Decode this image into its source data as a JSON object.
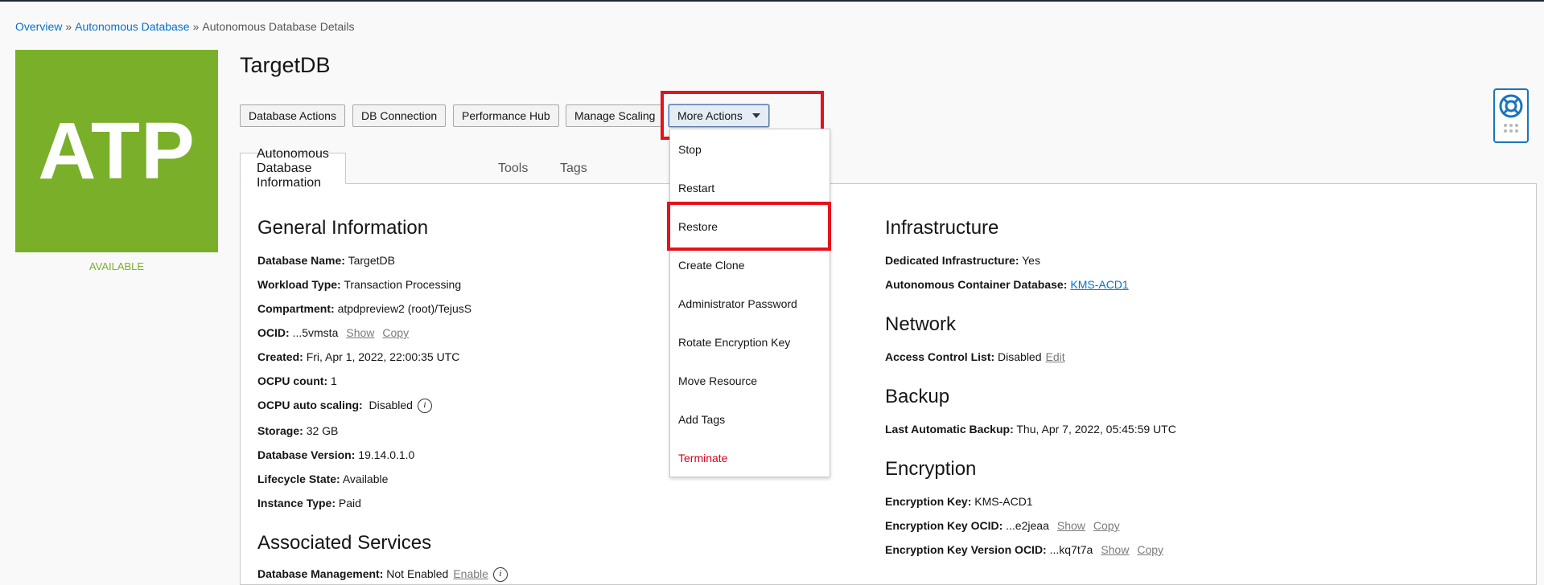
{
  "breadcrumb": {
    "items": [
      "Overview",
      "Autonomous Database",
      "Autonomous Database Details"
    ],
    "separator": "»"
  },
  "badge": {
    "text": "ATP",
    "status": "AVAILABLE",
    "color": "#7aaf29"
  },
  "title": "TargetDB",
  "actions": {
    "database_actions": "Database Actions",
    "db_connection": "DB Connection",
    "performance_hub": "Performance Hub",
    "manage_scaling": "Manage Scaling",
    "more_actions": "More Actions"
  },
  "tabs": [
    "Autonomous Database Information",
    "Tools",
    "Tags"
  ],
  "menu": {
    "items": [
      "Stop",
      "Restart",
      "Restore",
      "Create Clone",
      "Administrator Password",
      "Rotate Encryption Key",
      "Move Resource",
      "Add Tags",
      "Terminate"
    ]
  },
  "general": {
    "heading": "General Information",
    "rows": [
      {
        "label": "Database Name:",
        "value": "TargetDB"
      },
      {
        "label": "Workload Type:",
        "value": "Transaction Processing"
      },
      {
        "label": "Compartment:",
        "value": "atpdpreview2 (root)/TejusS"
      },
      {
        "label": "OCID:",
        "value": "...5vmsta",
        "link1": "Show",
        "link2": "Copy"
      },
      {
        "label": "Created:",
        "value": "Fri, Apr 1, 2022, 22:00:35 UTC"
      },
      {
        "label": "OCPU count:",
        "value": "1"
      },
      {
        "label": "OCPU auto scaling:",
        "value": "Disabled",
        "icon": "i"
      },
      {
        "label": "Storage:",
        "value": "32 GB"
      },
      {
        "label": "Database Version:",
        "value": "19.14.0.1.0"
      },
      {
        "label": "Lifecycle State:",
        "value": "Available"
      },
      {
        "label": "Instance Type:",
        "value": "Paid"
      }
    ]
  },
  "associated": {
    "heading": "Associated Services",
    "rows": [
      {
        "label": "Database Management:",
        "value": "Not Enabled",
        "link": "Enable",
        "icon": "i"
      }
    ]
  },
  "infrastructure": {
    "heading": "Infrastructure",
    "dedicated_label": "Dedicated Infrastructure:",
    "dedicated_value": "Yes",
    "acd_label": "Autonomous Container Database:",
    "acd_value": "KMS-ACD1"
  },
  "network": {
    "heading": "Network",
    "acl_label": "Access Control List:",
    "acl_value": "Disabled",
    "acl_link": "Edit"
  },
  "backup": {
    "heading": "Backup",
    "label": "Last Automatic Backup:",
    "value": "Thu, Apr 7, 2022, 05:45:59 UTC"
  },
  "encryption": {
    "heading": "Encryption",
    "key_label": "Encryption Key:",
    "key_value": "KMS-ACD1",
    "ocid_label": "Encryption Key OCID:",
    "ocid_value": "...e2jeaa",
    "version_label": "Encryption Key Version OCID:",
    "version_value": "...kq7t7a",
    "show": "Show",
    "copy": "Copy"
  },
  "colors": {
    "accent_link": "#0572ce",
    "highlight": "#e6121b",
    "danger": "#d0021b"
  }
}
